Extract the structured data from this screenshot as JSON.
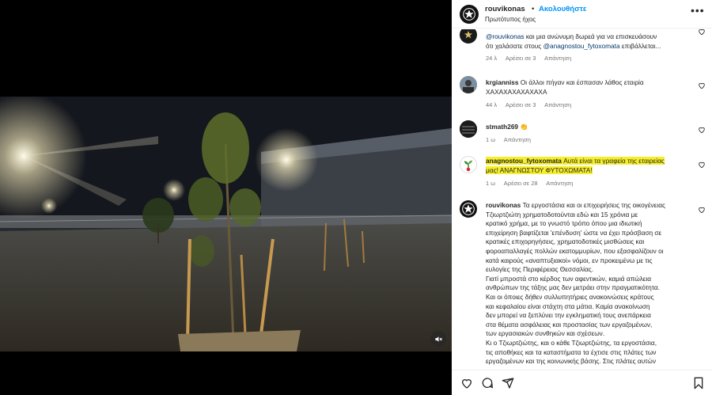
{
  "header": {
    "username": "rouvikonas",
    "dot": "•",
    "follow_label": "Ακολουθήστε",
    "audio": "Πρωτότυπος ήχος",
    "more_icon": "more-horizontal-icon"
  },
  "comments": [
    {
      "line1_mention": "@rouvikonas",
      "line1_rest": " και μια ανώνυμη δωρεά για να επισκευάσουν",
      "line2_start": "ότι χαλάσατε στους ",
      "line2_mention": "@anagnostou_fytoxomata",
      "line2_rest": " επιβάλλεται...",
      "time": "24 λ",
      "likes": "Αρέσει σε 3",
      "reply": "Απάντηση"
    },
    {
      "username": "krgianniss",
      "line1": " Οι άλλοι πήγαν και έσπασαν λάθος εταιρία",
      "line2": "ΧΑΧΑΧΑΧΑΧΑΧΑΧΑ",
      "time": "44 λ",
      "likes": "Αρέσει σε 3",
      "reply": "Απάντηση"
    },
    {
      "username": "stmath269",
      "emoji": "👏",
      "time": "1 ω",
      "reply": "Απάντηση"
    },
    {
      "username": "anagnostou_fytoxomata",
      "line1": " Αυτά είναι τα γραφεία της εταιρείας",
      "line2": "μας! ΑΝΑΓΝΩΣΤΟΥ ΦΥΤΟΧΩΜΑΤΑ!",
      "time": "1 ω",
      "likes": "Αρέσει σε 28",
      "reply": "Απάντηση"
    },
    {
      "username": "rouvikonas",
      "lines": [
        " Τα εργοστάσια και οι επιχειρήσεις της οικογένειας",
        "Τζιωρτζιώτη χρηματοδοτούνται εδώ και 15 χρόνια με",
        "κρατικό χρήμα, με το γνωστό τρόπο όπου μια ιδιωτική",
        "επιχείρηση βαφτίζεται 'επένδυση' ώστε να έχει πρόσβαση σε",
        "κρατικές επιχορηγήσεις, χρηματοδοτικές μισθώσεις και",
        "φοροαπαλλαγές πολλών εκατομμυρίων, που εξασφαλίζουν οι",
        "κατά καιρούς «αναπτυξιακοί» νόμοι, εν προκειμένω με τις",
        "ευλογίες της Περιφέρειας Θεσσαλίας.",
        "Γιατί μπροστά στο κέρδος των αφεντικών, καμιά απώλεια",
        "ανθρώπων της τάξης μας δεν μετράει στην πραγματικότητα.",
        "Και οι όποιες δήθεν συλλυπητήριες ανακοινώσεις κράτους",
        "και κεφαλαίου είναι στάχτη στα μάτια. Καμία ανακοίνωση",
        "δεν μπορεί να ξεπλύνει την εγκληματική τους ανεπάρκεια",
        "στα θέματα ασφάλειας και προστασίας των εργαζομένων,",
        "των εργασιακών συνθηκών και σχέσεων.",
        "Κι ο Τζιωρτζιώτης, και ο κάθε Τζιωρτζιώτης, τα εργοστάσια,",
        "τις αποθήκες και τα καταστήματα τα έχτισε στις πλάτες των",
        "εργαζομένων και της κοινωνικής βάσης. Στις πλάτες αυτών"
      ]
    }
  ],
  "colors": {
    "link": "#0095f6",
    "mention": "#00376b",
    "highlight": "#f5ee2a",
    "text": "#262626",
    "meta": "#737373"
  }
}
